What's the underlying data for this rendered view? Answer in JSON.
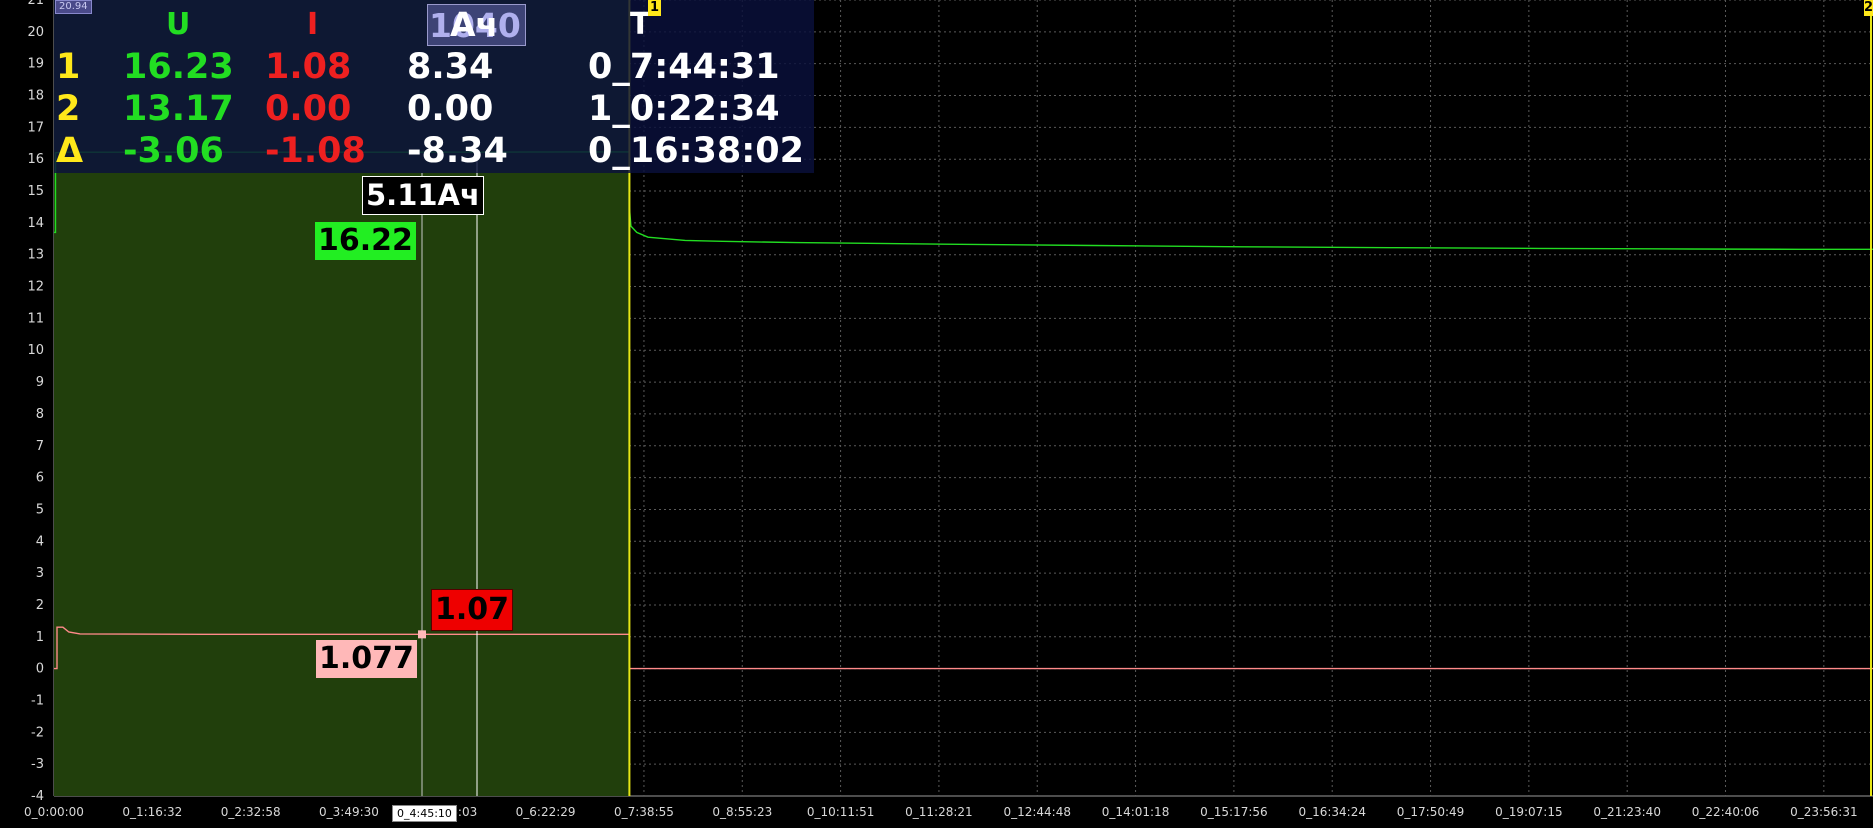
{
  "chart_data": {
    "type": "line",
    "y_ticks": [
      "21",
      "20",
      "19",
      "18",
      "17",
      "16",
      "15",
      "14",
      "13",
      "12",
      "11",
      "10",
      "9",
      "8",
      "7",
      "6",
      "5",
      "4",
      "3",
      "2",
      "1",
      "0",
      "-1",
      "-2",
      "-3",
      "-4"
    ],
    "x_ticks": [
      "0_0:00:00",
      "0_1:16:32",
      "0_2:32:58",
      "0_3:49:30",
      "0_5:06:03",
      "0_6:22:29",
      "0_7:38:55",
      "0_8:55:23",
      "0_10:11:51",
      "0_11:28:21",
      "0_12:44:48",
      "0_14:01:18",
      "0_15:17:56",
      "0_16:34:24",
      "0_17:50:49",
      "0_19:07:15",
      "0_21:23:40",
      "0_22:40:06",
      "0_23:56:31"
    ],
    "ylim": [
      -4,
      21
    ],
    "xlim_hours": [
      0,
      24.5
    ],
    "grid": true,
    "series": [
      {
        "color": "#22dd22",
        "x_hours": [
          0,
          0.02,
          0.02,
          0.1,
          0.1,
          1,
          3,
          5,
          7,
          7.75,
          7.75,
          7.77,
          7.85,
          8,
          8.5,
          9,
          10,
          12,
          14,
          16,
          18,
          20,
          22,
          23.5,
          24.5
        ],
        "values": [
          13.7,
          13.7,
          16.2,
          16.22,
          16.22,
          16.22,
          16.22,
          16.22,
          16.23,
          16.23,
          14.5,
          13.9,
          13.7,
          13.55,
          13.45,
          13.42,
          13.38,
          13.33,
          13.29,
          13.25,
          13.22,
          13.2,
          13.18,
          13.17,
          13.17
        ]
      },
      {
        "color": "#ff8a8a",
        "x_hours": [
          0,
          0.04,
          0.04,
          0.12,
          0.2,
          0.35,
          2,
          4,
          5,
          6,
          7,
          7.75,
          7.75,
          10,
          15,
          20,
          24.5
        ],
        "values": [
          0,
          0,
          1.3,
          1.3,
          1.15,
          1.09,
          1.08,
          1.077,
          1.08,
          1.08,
          1.08,
          1.08,
          0,
          0,
          0,
          0,
          0
        ]
      }
    ],
    "overlay_label": "20.94"
  },
  "selection": {
    "start_hours": 0,
    "end_hours": 7.75,
    "fill": "#213f0c",
    "cursor1_label": "1",
    "cursor2_label": "2",
    "cursor_color": "#e6e615"
  },
  "measure_table": {
    "headers": {
      "u": "U",
      "i": "I",
      "ah": "Ач",
      "t": "T"
    },
    "overlay_number": "1040",
    "rows": [
      {
        "label": "1",
        "u": "16.23",
        "i": "1.08",
        "ah": "8.34",
        "t": "0_7:44:31"
      },
      {
        "label": "2",
        "u": "13.17",
        "i": "0.00",
        "ah": "0.00",
        "t": "1_0:22:34"
      },
      {
        "label": "Δ",
        "u": "-3.06",
        "i": "-1.08",
        "ah": "-8.34",
        "t": "0_16:38:02"
      }
    ]
  },
  "probe": {
    "ah_label": "5.11Ач",
    "u_label": "16.22",
    "i_label": "1.07",
    "i_label2": "1.077",
    "time_label": "0_4:45:10"
  }
}
